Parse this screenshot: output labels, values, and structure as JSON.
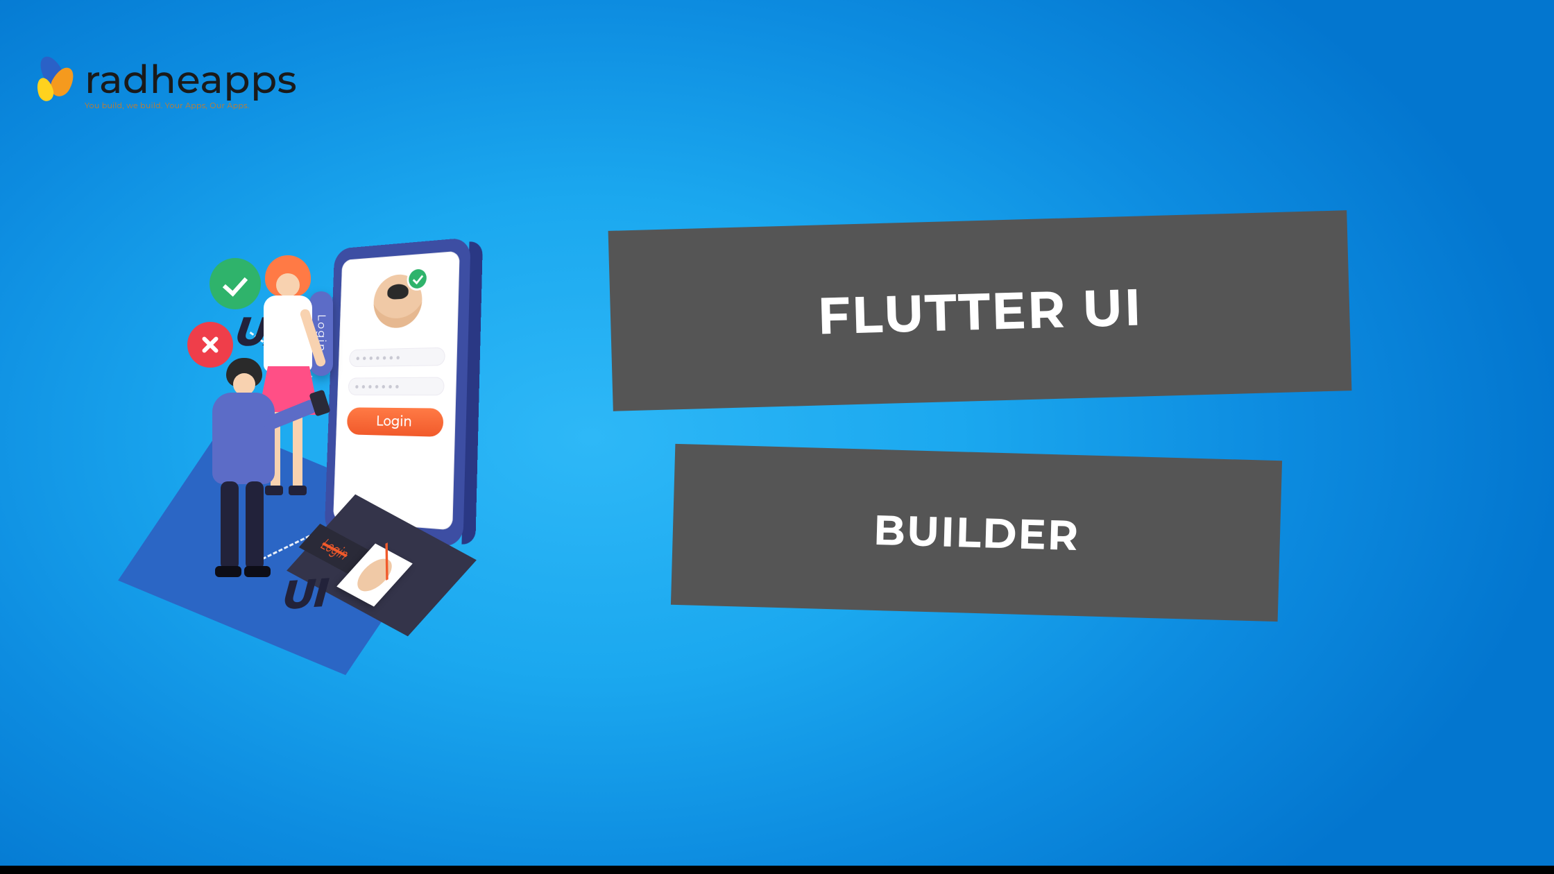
{
  "logo": {
    "word": "radheapps",
    "tagline": "You build, we build. Your Apps, Our Apps."
  },
  "titles": {
    "line1": "FLUTTER UI",
    "line2": "BUILDER"
  },
  "illustration": {
    "ux_label": "UX",
    "ui_label": "UI",
    "login_pill": "Login",
    "login_button": "Login",
    "slab_login": "Login"
  }
}
